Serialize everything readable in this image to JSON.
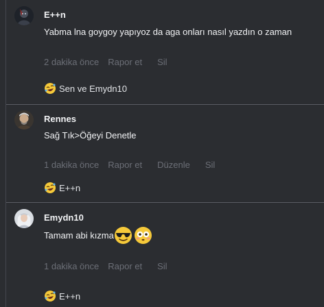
{
  "comments": [
    {
      "author": "E++n",
      "text": "Yabma lna goygoy yapıyoz da aga onları nasıl yazdın o zaman",
      "time": "2 dakika önce",
      "actions": [
        "Rapor et",
        "Sil"
      ],
      "reaction_text": "Sen ve Emydn10",
      "avatar_icon": "dark-warrior-avatar"
    },
    {
      "author": "Rennes",
      "text": "Sağ Tık>Öğeyi Denetle",
      "time": "1 dakika önce",
      "actions": [
        "Rapor et",
        "Düzenle",
        "Sil"
      ],
      "reaction_text": "E++n",
      "avatar_icon": "bearded-witcher-avatar"
    },
    {
      "author": "Emydn10",
      "text": "Tamam abi kızma",
      "time": "1 dakika önce",
      "actions": [
        "Rapor et",
        "Sil"
      ],
      "reaction_text": "E++n",
      "avatar_icon": "white-haired-woman-avatar",
      "inline_emojis": [
        "sunglasses-face-emoji",
        "flushed-face-emoji"
      ]
    }
  ],
  "reaction_emoji": "rolling-on-floor-laughing-emoji",
  "colors": {
    "background": "#2b2d31",
    "text": "#f2f3f5",
    "muted": "#6c6f77",
    "divider": "#5a5d64"
  }
}
